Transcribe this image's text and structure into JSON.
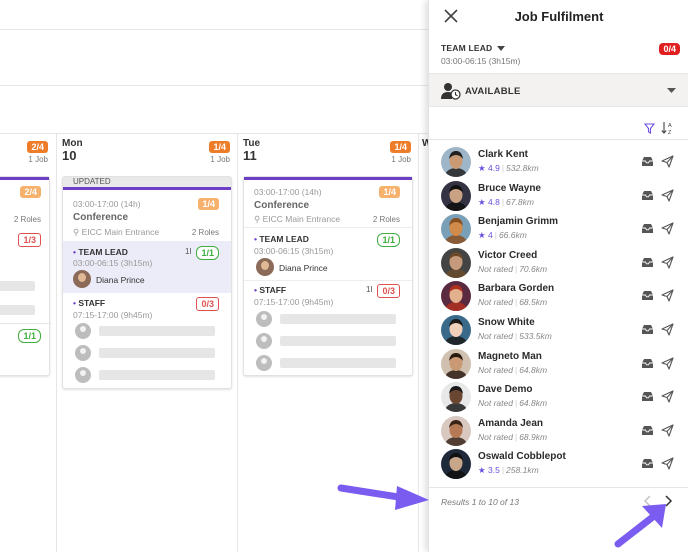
{
  "colors": {
    "accent": "#6c3fc6",
    "orange": "#ee7d2a",
    "red": "#e02020",
    "green": "#3fae3f",
    "arrow": "#7a5cf0"
  },
  "schedule": {
    "days": [
      {
        "name": "",
        "num": "",
        "badge": "2/4",
        "jobs": "1 Job"
      },
      {
        "name": "Mon",
        "num": "10",
        "badge": "1/4",
        "jobs": "1 Job"
      },
      {
        "name": "Tue",
        "num": "11",
        "badge": "1/4",
        "jobs": "1 Job"
      }
    ],
    "partial_card": {
      "badge": "2/4",
      "roles": "2 Roles",
      "count": "3",
      "count_badge": "1/3",
      "lead_badge": "1/1"
    },
    "mon_card": {
      "tag": "UPDATED",
      "time": "03:00-17:00 (14h)",
      "badge": "1/4",
      "title": "Conference",
      "location": "EICC Main Entrance",
      "roles": "2 Roles",
      "lead_label": "TEAM LEAD",
      "lead_count": "1",
      "lead_badge": "1/1",
      "lead_time": "03:00-06:15 (3h15m)",
      "lead_person": "Diana Prince",
      "staff_label": "STAFF",
      "staff_badge": "0/3",
      "staff_time": "07:15-17:00 (9h45m)"
    },
    "tue_card": {
      "time": "03:00-17:00 (14h)",
      "badge": "1/4",
      "title": "Conference",
      "location": "EICC Main Entrance",
      "roles": "2 Roles",
      "lead_label": "TEAM LEAD",
      "lead_badge": "1/1",
      "lead_time": "03:00-06:15 (3h15m)",
      "lead_person": "Diana Prince",
      "staff_label": "STAFF",
      "staff_count": "1",
      "staff_badge": "0/3",
      "staff_time": "07:15-17:00 (9h45m)"
    }
  },
  "panel": {
    "title": "Job Fulfilment",
    "team_name": "TEAM LEAD",
    "team_time": "03:00-06:15 (3h15m)",
    "team_badge": "0/4",
    "availability_label": "AVAILABLE",
    "people": [
      {
        "name": "Clark Kent",
        "rating": "4.9",
        "distance": "532.8km",
        "rated": true,
        "skin": "#c99a74",
        "hair": "#222",
        "bg": "#9fb6c8"
      },
      {
        "name": "Bruce Wayne",
        "rating": "4.8",
        "distance": "67.8km",
        "rated": true,
        "skin": "#caa283",
        "hair": "#111",
        "bg": "#334"
      },
      {
        "name": "Benjamin Grimm",
        "rating": "4",
        "distance": "66.6km",
        "rated": true,
        "skin": "#d08a4a",
        "hair": "#8a4f1f",
        "bg": "#7aa0b8"
      },
      {
        "name": "Victor Creed",
        "rating": "",
        "distance": "70.6km",
        "rated": false,
        "rated_text": "Not rated",
        "skin": "#c59a7a",
        "hair": "#6a4a2a",
        "bg": "#444"
      },
      {
        "name": "Barbara Gorden",
        "rating": "",
        "distance": "68.5km",
        "rated": false,
        "rated_text": "Not rated",
        "skin": "#e2b08a",
        "hair": "#b03020",
        "bg": "#5a2a40"
      },
      {
        "name": "Snow White",
        "rating": "",
        "distance": "533.5km",
        "rated": false,
        "rated_text": "Not rated",
        "skin": "#f0d0bb",
        "hair": "#1a1a1a",
        "bg": "#3a6a8a"
      },
      {
        "name": "Magneto Man",
        "rating": "",
        "distance": "64.8km",
        "rated": false,
        "rated_text": "Not rated",
        "skin": "#c99a74",
        "hair": "#2a1a10",
        "bg": "#d0c0b0"
      },
      {
        "name": "Dave Demo",
        "rating": "",
        "distance": "64.8km",
        "rated": false,
        "rated_text": "Not rated",
        "skin": "#6b4630",
        "hair": "#1a1a1a",
        "bg": "#e8e8e8"
      },
      {
        "name": "Amanda Jean",
        "rating": "",
        "distance": "68.9km",
        "rated": false,
        "rated_text": "Not rated",
        "skin": "#b57a55",
        "hair": "#3a2418",
        "bg": "#d8c8c0"
      },
      {
        "name": "Oswald Cobblepot",
        "rating": "3.5",
        "distance": "258.1km",
        "rated": true,
        "skin": "#c8a68a",
        "hair": "#111",
        "bg": "#1e2a3a"
      }
    ],
    "results_text": "Results 1 to 10 of 13"
  },
  "icons": [
    "close-icon",
    "chevron-down-icon",
    "person-clock-icon",
    "filter-icon",
    "sort-icon",
    "inbox-icon",
    "send-icon",
    "chevron-left-icon",
    "chevron-right-icon",
    "location-pin-icon",
    "star-icon"
  ]
}
